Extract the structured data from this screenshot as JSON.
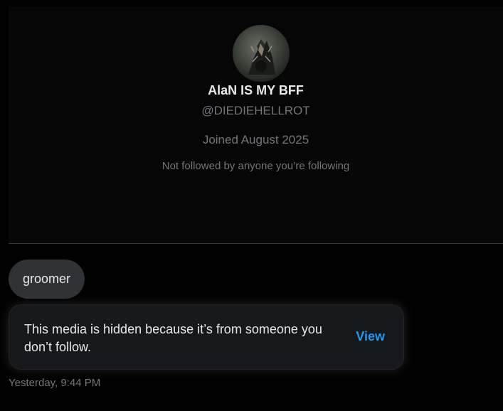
{
  "profile": {
    "display_name": "AlaN IS MY BFF",
    "handle": "@DIEDIEHELLROT",
    "joined": "Joined August 2025",
    "follow_note": "Not followed by anyone you’re following",
    "avatar_icon": "avatar-image"
  },
  "conversation": {
    "message_text": "groomer",
    "hidden_media_text": "This media is hidden because it’s from someone you don’t follow.",
    "view_label": "View",
    "timestamp": "Yesterday, 9:44 PM"
  },
  "colors": {
    "background": "#000000",
    "bubble": "#2f3336",
    "accent": "#1d9bf0",
    "muted_text": "#71767b",
    "primary_text": "#e7e9ea"
  }
}
